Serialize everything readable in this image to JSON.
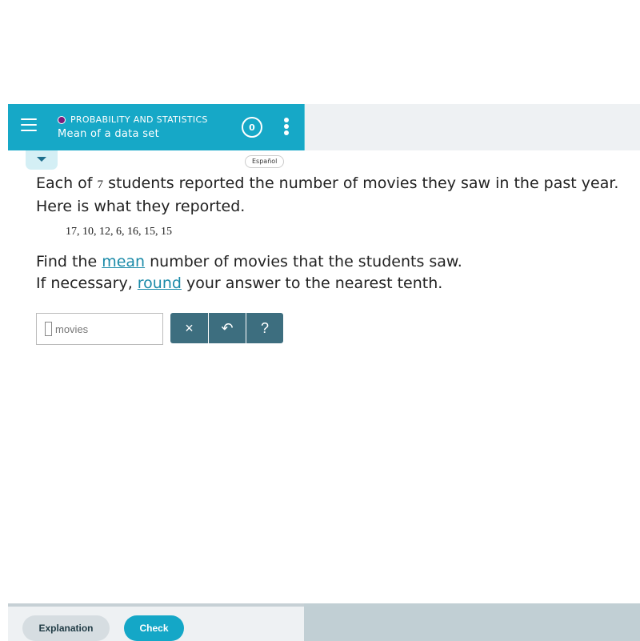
{
  "header": {
    "topic": "PROBABILITY AND STATISTICS",
    "title": "Mean of a data set",
    "score": "0",
    "topic_dot_color": "#7b1c7b",
    "brand_color": "#16a8c7"
  },
  "language_button": "Español",
  "question": {
    "part1": "Each of ",
    "count": "7",
    "part2": " students reported the number of movies they saw in the past year. Here is what they reported.",
    "data_values": "17, 10, 12, 6, 16, 15, 15"
  },
  "instruction": {
    "line1_pre": "Find the ",
    "line1_link": "mean",
    "line1_post": " number of movies that the students saw.",
    "line2_pre": "If necessary, ",
    "line2_link": "round",
    "line2_post": " your answer to the nearest tenth."
  },
  "answer": {
    "value": "",
    "unit": "movies"
  },
  "tools": {
    "clear": "×",
    "undo": "↶",
    "help": "?"
  },
  "footer": {
    "explanation_label": "Explanation",
    "check_label": "Check"
  }
}
